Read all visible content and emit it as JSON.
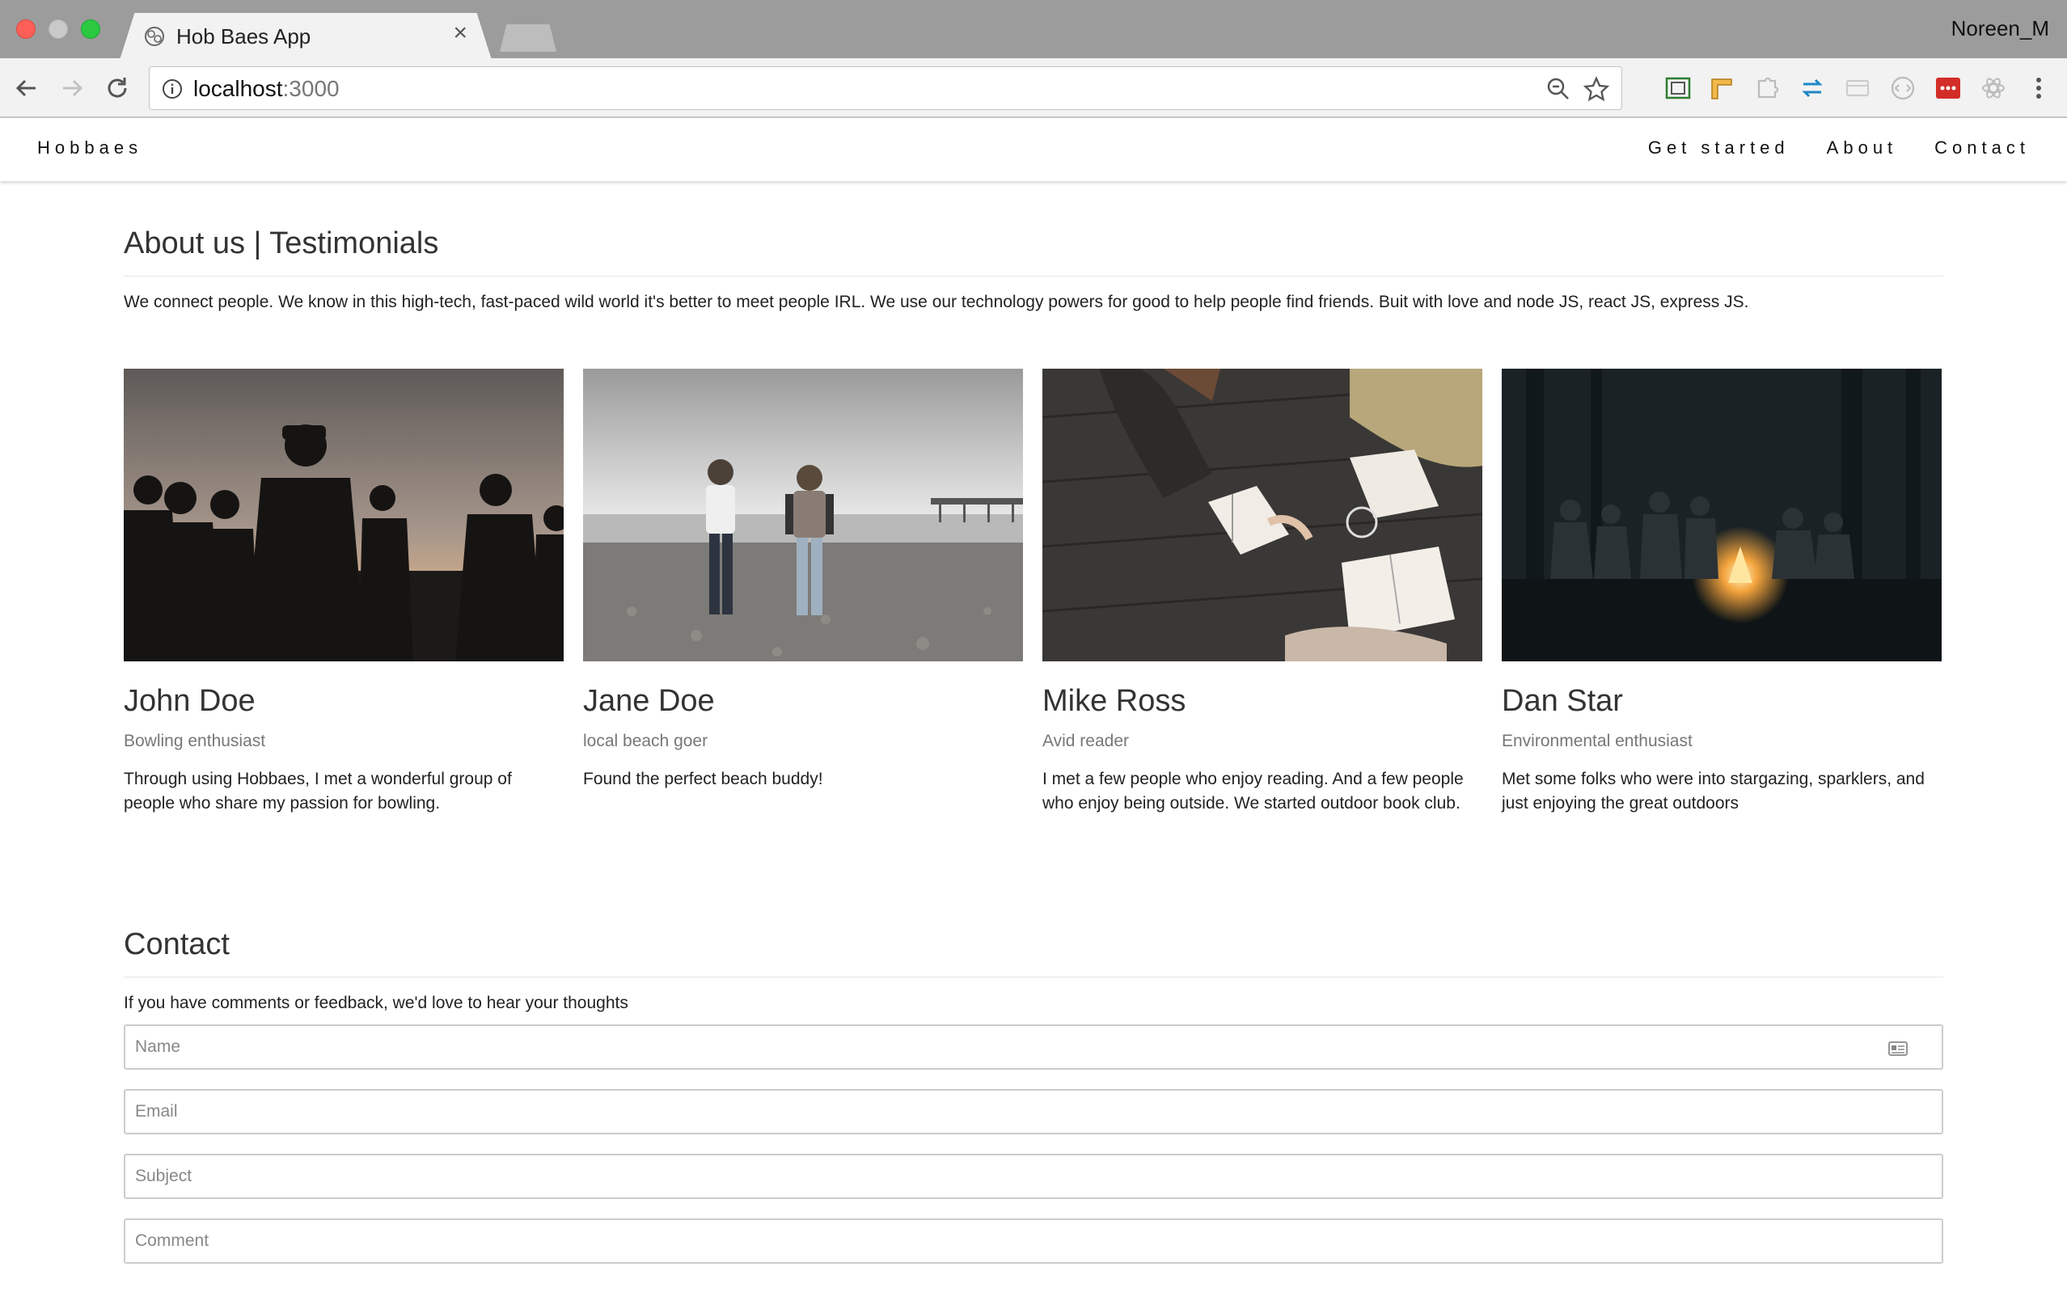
{
  "browser": {
    "tab_title": "Hob Baes App",
    "tab_close": "×",
    "profile": "Noreen_M",
    "url_host": "localhost",
    "url_port": ":3000"
  },
  "navbar": {
    "brand": "Hobbaes",
    "links": [
      "Get started",
      "About",
      "Contact"
    ]
  },
  "about": {
    "title": "About us | Testimonials",
    "text": "We connect people. We know in this high-tech, fast-paced wild world it's better to meet people IRL. We use our technology powers for good to help people find friends. Buit with love and node JS, react JS, express JS."
  },
  "testimonials": [
    {
      "name": "John Doe",
      "role": "Bowling enthusiast",
      "quote": "Through using Hobbaes, I met a wonderful group of people who share my passion for bowling.",
      "image": "silhouettes-at-sunset"
    },
    {
      "name": "Jane Doe",
      "role": "local beach goer",
      "quote": "Found the perfect beach buddy!",
      "image": "two-women-on-beach"
    },
    {
      "name": "Mike Ross",
      "role": "Avid reader",
      "quote": "I met a few people who enjoy reading. And a few people who enjoy being outside. We started outdoor book club.",
      "image": "reading-at-picnic-table"
    },
    {
      "name": "Dan Star",
      "role": "Environmental enthusiast",
      "quote": "Met some folks who were into stargazing, sparklers, and just enjoying the great outdoors",
      "image": "campfire-in-forest"
    }
  ],
  "contact": {
    "title": "Contact",
    "text": "If you have comments or feedback, we'd love to hear your thoughts",
    "fields": {
      "name_placeholder": "Name",
      "email_placeholder": "Email",
      "subject_placeholder": "Subject",
      "comment_placeholder": "Comment"
    }
  },
  "colors": {
    "titlebar": "#9c9c9c",
    "toolbar": "#f2f2f2",
    "heading": "#333333",
    "muted": "#777777"
  }
}
